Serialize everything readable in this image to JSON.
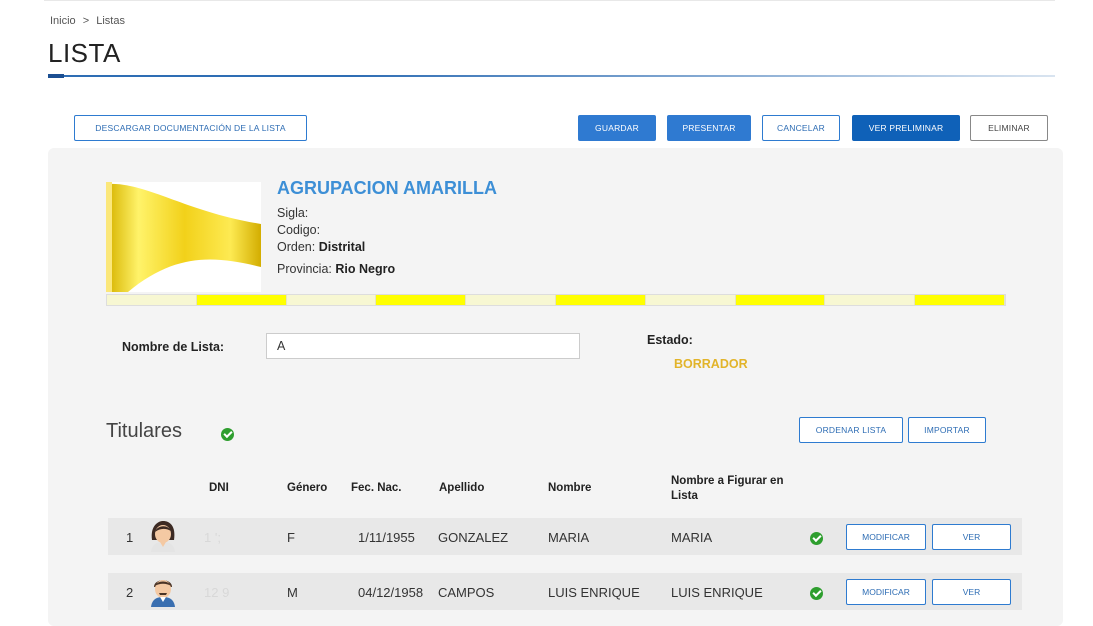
{
  "breadcrumb": {
    "home": "Inicio",
    "separator": ">",
    "current": "Listas"
  },
  "page_title": "LISTA",
  "toolbar": {
    "download_doc": "DESCARGAR DOCUMENTACIÓN DE LA LISTA",
    "guardar": "GUARDAR",
    "presentar": "PRESENTAR",
    "cancelar": "CANCELAR",
    "ver_preliminar": "VER PRELIMINAR",
    "eliminar": "ELIMINAR"
  },
  "party": {
    "name": "AGRUPACION AMARILLA",
    "sigla_label": "Sigla:",
    "codigo_label": "Codigo:",
    "orden_label": "Orden:",
    "orden_value": "Distrital",
    "provincia_label": "Provincia:",
    "provincia_value": "Rio Negro"
  },
  "form": {
    "nombre_label": "Nombre de Lista:",
    "nombre_value": "A",
    "estado_label": "Estado:",
    "estado_value": "BORRADOR"
  },
  "titulares": {
    "title": "Titulares",
    "ordenar": "ORDENAR LISTA",
    "importar": "IMPORTAR"
  },
  "table": {
    "headers": {
      "dni": "DNI",
      "genero": "Género",
      "fec_nac": "Fec. Nac.",
      "apellido": "Apellido",
      "nombre": "Nombre",
      "figurar": "Nombre a Figurar en Lista"
    },
    "rows": [
      {
        "num": "1",
        "dni": "1       ';",
        "genero": "F",
        "fec_nac": "1/11/1955",
        "apellido": "GONZALEZ",
        "nombre": "MARIA",
        "figurar": "MARIA",
        "modificar": "MODIFICAR",
        "ver": "VER"
      },
      {
        "num": "2",
        "dni": "12       9",
        "genero": "M",
        "fec_nac": "04/12/1958",
        "apellido": "CAMPOS",
        "nombre": "LUIS ENRIQUE",
        "figurar": "LUIS ENRIQUE",
        "modificar": "MODIFICAR",
        "ver": "VER"
      }
    ]
  },
  "colors": {
    "accent": "#2f7ad1",
    "status": "#e2b42a",
    "flag": "#f5df25",
    "ok": "#2e9e2e"
  }
}
